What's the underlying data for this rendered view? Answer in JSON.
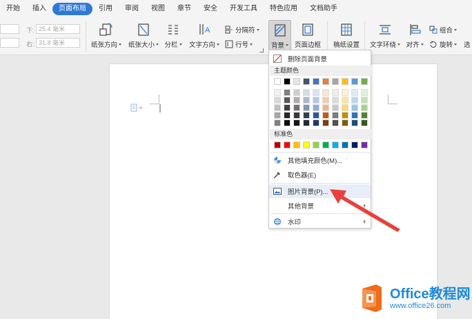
{
  "menu": {
    "tabs": [
      "开始",
      "插入",
      "页面布局",
      "引用",
      "审阅",
      "视图",
      "章节",
      "安全",
      "开发工具",
      "特色应用",
      "文档助手"
    ],
    "active_index": 2
  },
  "ribbon": {
    "margin_fields": {
      "top_label": "上:",
      "top_value": "",
      "bottom_label": "下:",
      "bottom_value": "25.4 毫米",
      "left_label": "左:",
      "left_value": "",
      "right_label": "右:",
      "right_value": "31.8 毫米"
    },
    "orientation": "纸张方向",
    "size": "纸张大小",
    "columns": "分栏",
    "text_direction": "文字方向",
    "separator": "分隔符",
    "line_numbers": "行号",
    "background": "背景",
    "page_border": "页面边框",
    "paper_setup": "稿纸设置",
    "text_wrap": "文字环绕",
    "align": "对齐",
    "group": "组合",
    "rotate": "旋转",
    "select": "选"
  },
  "dropdown": {
    "remove_background": "删除页面背景",
    "theme_colors_label": "主题颜色",
    "standard_colors_label": "标准色",
    "more_fill_colors": "其他填充颜色(M)...",
    "eyedropper": "取色器(E)",
    "picture_background": "图片背景(P)...",
    "other_background": "其他背景",
    "watermark": "水印",
    "theme_top_row": [
      "#ffffff",
      "#000000",
      "#e7e6e6",
      "#44546a",
      "#4472c4",
      "#ed7d31",
      "#a5a5a5",
      "#ffc000",
      "#5b9bd5",
      "#70ad47"
    ],
    "theme_shades": [
      [
        "#f2f2f2",
        "#808080",
        "#d0cece",
        "#d6dce4",
        "#dae3f3",
        "#fbe5d6",
        "#ededed",
        "#fff2cc",
        "#deebf7",
        "#e2f0d9"
      ],
      [
        "#d9d9d9",
        "#595959",
        "#aeabab",
        "#adb9ca",
        "#b4c7e7",
        "#f8cbad",
        "#dbdbdb",
        "#ffe699",
        "#bdd7ee",
        "#c5e0b4"
      ],
      [
        "#bfbfbf",
        "#404040",
        "#757171",
        "#8497b0",
        "#8faadc",
        "#f4b183",
        "#c9c9c9",
        "#ffd966",
        "#9dc3e6",
        "#a9d18e"
      ],
      [
        "#a6a6a6",
        "#262626",
        "#3a3838",
        "#333f50",
        "#2f5597",
        "#c55a11",
        "#7b7b7b",
        "#bf9000",
        "#2e75b6",
        "#548235"
      ],
      [
        "#808080",
        "#0d0d0d",
        "#171616",
        "#222a35",
        "#203864",
        "#843c0c",
        "#525252",
        "#7f6000",
        "#1f4e79",
        "#385723"
      ]
    ],
    "standard_colors": [
      "#c00000",
      "#ff0000",
      "#ffc000",
      "#ffff00",
      "#92d050",
      "#00b050",
      "#00b0f0",
      "#0070c0",
      "#002060",
      "#7030a0"
    ]
  },
  "colors": {
    "accent": "#2e79d6",
    "arrow_red": "#e8413b",
    "logo_orange": "#ef6c1a",
    "logo_blue": "#1e8ad8"
  },
  "watermark_logo": {
    "main": "Office教程网",
    "sub": "www.office26.com"
  }
}
